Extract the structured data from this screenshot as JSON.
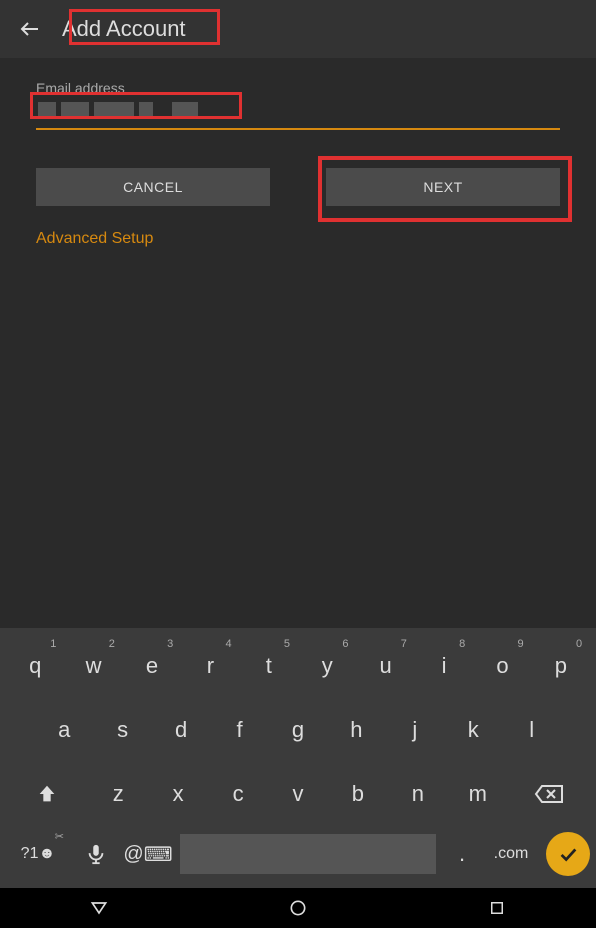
{
  "header": {
    "title": "Add Account"
  },
  "form": {
    "email_label": "Email address",
    "cancel": "CANCEL",
    "next": "NEXT",
    "advanced": "Advanced Setup"
  },
  "keyboard": {
    "row1": [
      {
        "main": "q",
        "sup": "1"
      },
      {
        "main": "w",
        "sup": "2"
      },
      {
        "main": "e",
        "sup": "3"
      },
      {
        "main": "r",
        "sup": "4"
      },
      {
        "main": "t",
        "sup": "5"
      },
      {
        "main": "y",
        "sup": "6"
      },
      {
        "main": "u",
        "sup": "7"
      },
      {
        "main": "i",
        "sup": "8"
      },
      {
        "main": "o",
        "sup": "9"
      },
      {
        "main": "p",
        "sup": "0"
      }
    ],
    "row2": [
      "a",
      "s",
      "d",
      "f",
      "g",
      "h",
      "j",
      "k",
      "l"
    ],
    "row3": [
      "z",
      "x",
      "c",
      "v",
      "b",
      "n",
      "m"
    ],
    "sym": "?1☻",
    "at": "@",
    "dot": ".",
    "com": ".com"
  }
}
